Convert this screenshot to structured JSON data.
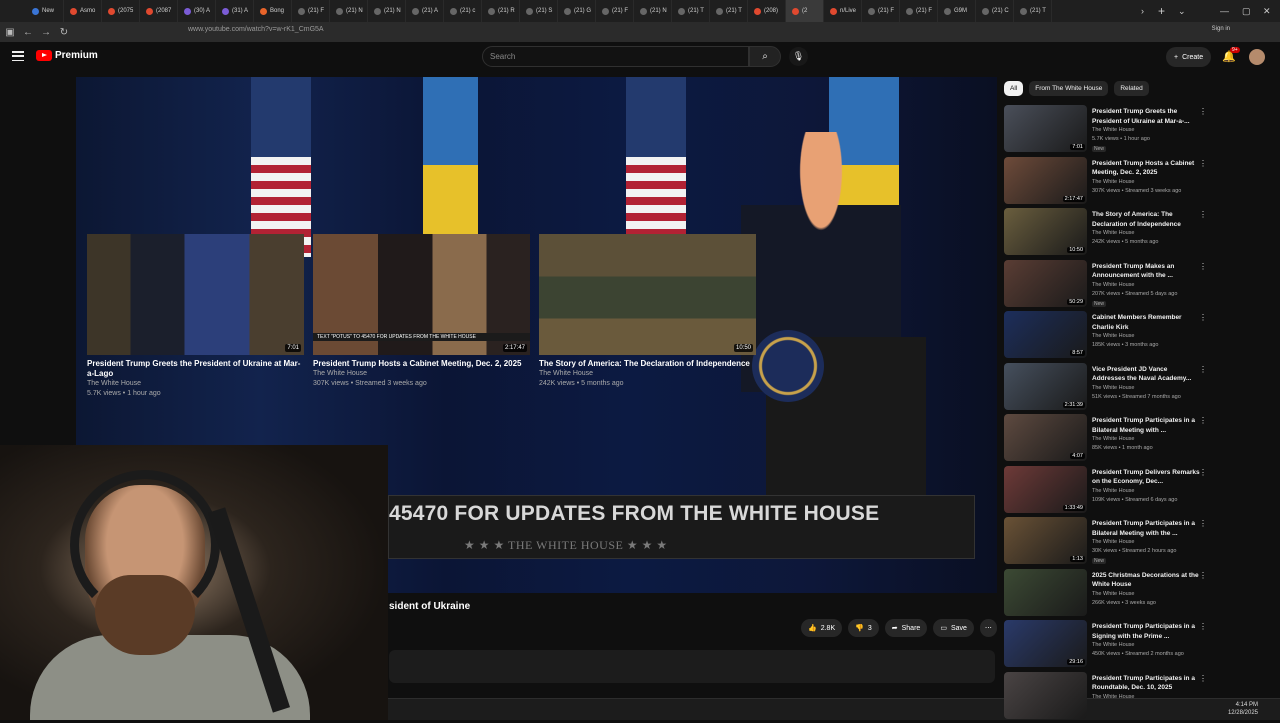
{
  "browser": {
    "tabs": [
      "New",
      "Asmo",
      "(2075",
      "(2087",
      "(30) A",
      "(31) A",
      "Bong",
      "(21) F",
      "(21) N",
      "(21) N",
      "(21) A",
      "(21) c",
      "(21) R",
      "(21) S",
      "(21) G",
      "(21) F",
      "(21) N",
      "(21) T",
      "(21) T",
      "(208)",
      "(2",
      "n/Live",
      "(21) F",
      "(21) F",
      "G9M",
      "(21) C",
      "(21) T"
    ],
    "tab_colors": [
      "#3a75d6",
      "#e0492f",
      "#e0492f",
      "#e0492f",
      "#7b5cd6",
      "#7b5cd6",
      "#e8642a",
      "#666",
      "#666",
      "#666",
      "#666",
      "#666",
      "#666",
      "#666",
      "#666",
      "#666",
      "#666",
      "#666",
      "#666",
      "#e0492f",
      "#e0492f",
      "#e0492f",
      "#666",
      "#666",
      "#666",
      "#666",
      "#666"
    ],
    "url": "www.youtube.com/watch?v=w-rK1_CmG5A",
    "sign_in": "Sign in"
  },
  "header": {
    "logo": "Premium",
    "search_placeholder": "Search",
    "create_label": "Create",
    "notif_count": "9+"
  },
  "player": {
    "banner_text": "45470 FOR UPDATES FROM THE WHITE HOUSE",
    "banner_sub": "★ ★ ★  THE WHITE HOUSE  ★ ★ ★",
    "end_cards": [
      {
        "title": "President Trump Greets the President of Ukraine at Mar-a-Lago",
        "channel": "The White House",
        "meta": "5.7K views • 1 hour ago",
        "duration": "7:01"
      },
      {
        "title": "President Trump Hosts a Cabinet Meeting, Dec. 2, 2025",
        "channel": "The White House",
        "meta": "307K views • Streamed 3 weeks ago",
        "duration": "2:17:47",
        "caption": "TEXT \"POTUS\" TO 45470 FOR UPDATES FROM THE WHITE HOUSE"
      },
      {
        "title": "The Story of America: The Declaration of Independence",
        "channel": "The White House",
        "meta": "242K views • 5 months ago",
        "duration": "10:50"
      }
    ]
  },
  "video": {
    "title": "sident of Ukraine",
    "likes": "2.8K",
    "dislikes": "3",
    "share": "Share",
    "save": "Save"
  },
  "chips": [
    "All",
    "From The White House",
    "Related"
  ],
  "sidebar": [
    {
      "title": "President Trump Greets the President of Ukraine at Mar-a-...",
      "channel": "The White House",
      "stats": "5.7K views • 1 hour ago",
      "duration": "7:01",
      "new": "New",
      "color": "#4a4f5a"
    },
    {
      "title": "President Trump Hosts a Cabinet Meeting, Dec. 2, 2025",
      "channel": "The White House",
      "stats": "307K views • Streamed 3 weeks ago",
      "duration": "2:17:47",
      "color": "#6e4b3a"
    },
    {
      "title": "The Story of America: The Declaration of Independence",
      "channel": "The White House",
      "stats": "242K views • 5 months ago",
      "duration": "10:50",
      "color": "#6a5e3e"
    },
    {
      "title": "President Trump Makes an Announcement with the ...",
      "channel": "The White House",
      "stats": "207K views • Streamed 5 days ago",
      "duration": "50:29",
      "new": "New",
      "color": "#5a3d34"
    },
    {
      "title": "Cabinet Members Remember Charlie Kirk",
      "channel": "The White House",
      "stats": "185K views • 3 months ago",
      "duration": "8:57",
      "color": "#1c2e5c"
    },
    {
      "title": "Vice President JD Vance Addresses the Naval Academy...",
      "channel": "The White House",
      "stats": "51K views • Streamed 7 months ago",
      "duration": "2:31:39",
      "color": "#46505e"
    },
    {
      "title": "President Trump Participates in a Bilateral Meeting with ...",
      "channel": "The White House",
      "stats": "85K views • 1 month ago",
      "duration": "4:07",
      "color": "#5e4a40"
    },
    {
      "title": "President Trump Delivers Remarks on the Economy, Dec...",
      "channel": "The White House",
      "stats": "109K views • Streamed 6 days ago",
      "duration": "1:33:49",
      "color": "#6e3a38"
    },
    {
      "title": "President Trump Participates in a Bilateral Meeting with the ...",
      "channel": "The White House",
      "stats": "30K views • Streamed 2 hours ago",
      "duration": "1:13",
      "new": "New",
      "color": "#6a5236"
    },
    {
      "title": "2025 Christmas Decorations at the White House",
      "channel": "The White House",
      "stats": "266K views • 3 weeks ago",
      "duration": "",
      "color": "#3c4a34"
    },
    {
      "title": "President Trump Participates in a Signing with the Prime ...",
      "channel": "The White House",
      "stats": "450K views • Streamed 2 months ago",
      "duration": "29:16",
      "color": "#2a3a6a"
    },
    {
      "title": "President Trump Participates in a Roundtable, Dec. 10, 2025",
      "channel": "The White House",
      "stats": "",
      "duration": "",
      "color": "#4a4444"
    }
  ],
  "clock": {
    "time": "4:14 PM",
    "date": "12/28/2025"
  }
}
